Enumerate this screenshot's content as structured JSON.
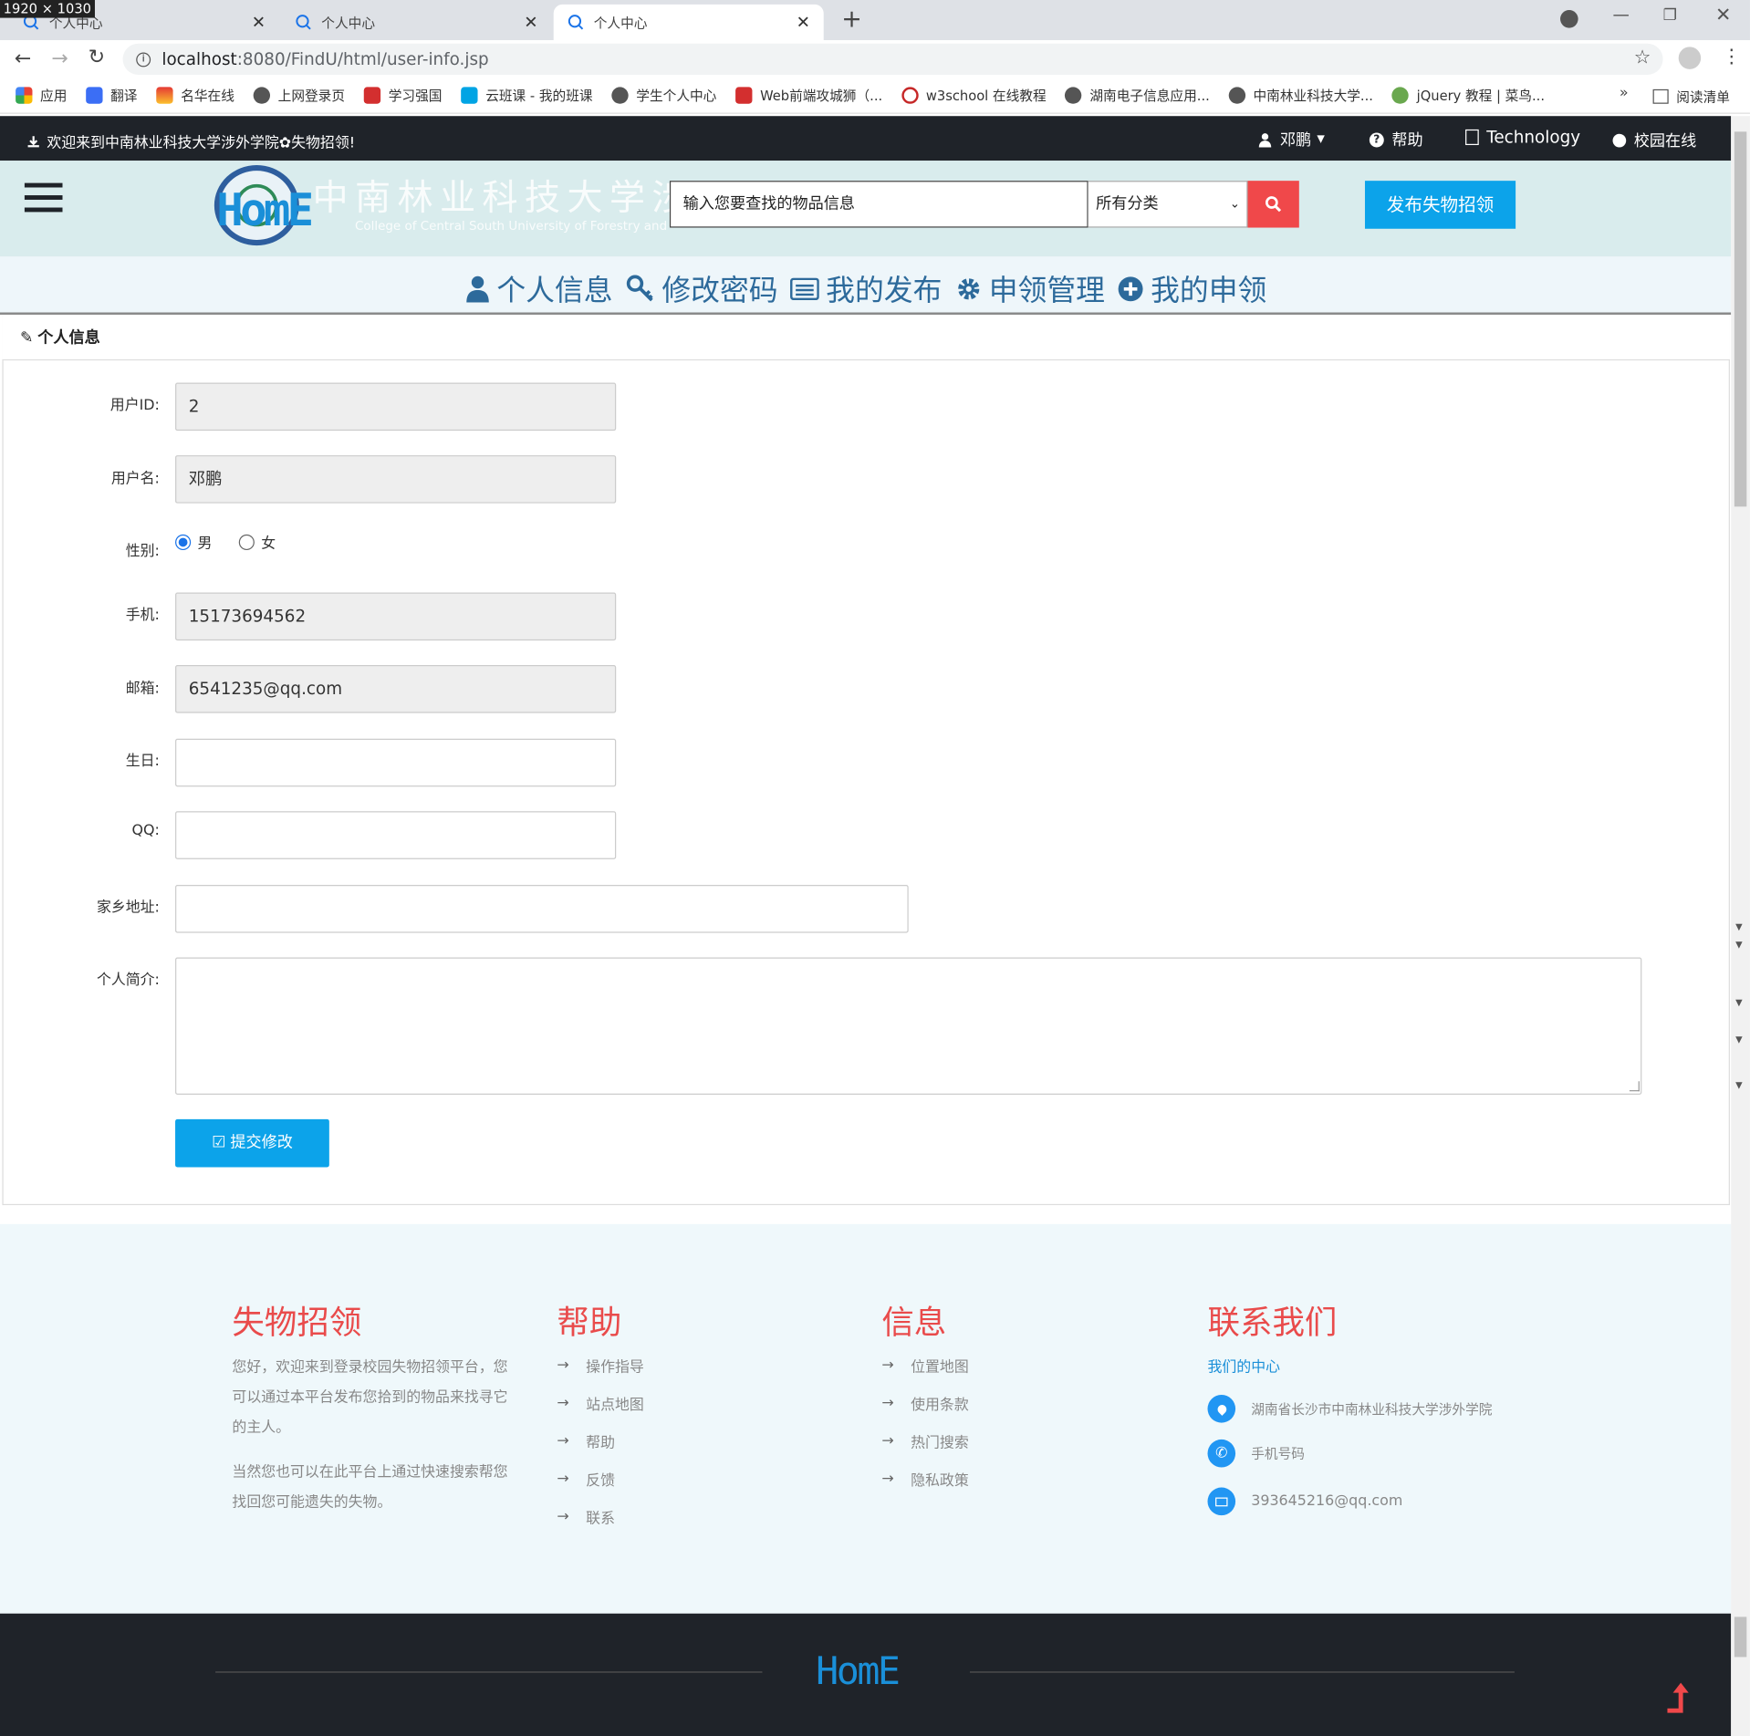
{
  "browser": {
    "size_badge": "1920 × 1030",
    "tabs": [
      {
        "title": "个人中心",
        "active": false
      },
      {
        "title": "个人中心",
        "active": false
      },
      {
        "title": "个人中心",
        "active": true
      }
    ],
    "url_host": "localhost",
    "url_rest": ":8080/FindU/html/user-info.jsp",
    "bookmarks": [
      {
        "label": "应用",
        "color": "#4285f4"
      },
      {
        "label": "翻译",
        "color": "#3b6ef5"
      },
      {
        "label": "名华在线",
        "color": "#e53935"
      },
      {
        "label": "上网登录页",
        "color": "#555555"
      },
      {
        "label": "学习强国",
        "color": "#d32f2f"
      },
      {
        "label": "云班课 - 我的班课",
        "color": "#00a4e4"
      },
      {
        "label": "学生个人中心",
        "color": "#555555"
      },
      {
        "label": "Web前端攻城狮（...",
        "color": "#d32f2f"
      },
      {
        "label": "w3school 在线教程",
        "color": "#c62828"
      },
      {
        "label": "湖南电子信息应用...",
        "color": "#555555"
      },
      {
        "label": "中南林业科技大学...",
        "color": "#555555"
      },
      {
        "label": "jQuery 教程 | 菜鸟...",
        "color": "#6aa84f"
      }
    ],
    "more": "»",
    "reading_list": "阅读清单"
  },
  "topbar": {
    "welcome": "欢迎来到中南林业科技大学涉外学院✿失物招领!",
    "user": "邓鹏",
    "help": "帮助",
    "technology": "Technology",
    "campus": "校园在线"
  },
  "header": {
    "logo_text": "HomE",
    "logo_cn": "中南林业科技大学涉外学院",
    "logo_en": "College of Central South University of Forestry and Technology",
    "search_placeholder": "输入您要查找的物品信息",
    "category": "所有分类",
    "publish_label": "发布失物招领"
  },
  "subnav": [
    "个人信息",
    "修改密码",
    "我的发布",
    "申领管理",
    "我的申领"
  ],
  "panel": {
    "title": "个人信息",
    "fields": {
      "user_id": {
        "label": "用户ID:",
        "value": "2"
      },
      "username": {
        "label": "用户名:",
        "value": "邓鹏"
      },
      "gender": {
        "label": "性别:",
        "options": [
          "男",
          "女"
        ],
        "selected": "男"
      },
      "phone": {
        "label": "手机:",
        "value": "15173694562"
      },
      "email": {
        "label": "邮箱:",
        "value": "6541235@qq.com"
      },
      "birthday": {
        "label": "生日:",
        "value": ""
      },
      "qq": {
        "label": "QQ:",
        "value": ""
      },
      "hometown": {
        "label": "家乡地址:",
        "value": ""
      },
      "bio": {
        "label": "个人简介:",
        "value": ""
      }
    },
    "submit_label": "提交修改"
  },
  "footer": {
    "col1": {
      "heading": "失物招领",
      "p1": "您好，欢迎来到登录校园失物招领平台，您可以通过本平台发布您拾到的物品来找寻它的主人。",
      "p2": "当然您也可以在此平台上通过快速搜索帮您找回您可能遗失的失物。"
    },
    "col2": {
      "heading": "帮助",
      "links": [
        "操作指导",
        "站点地图",
        "帮助",
        "反馈",
        "联系"
      ]
    },
    "col3": {
      "heading": "信息",
      "links": [
        "位置地图",
        "使用条款",
        "热门搜索",
        "隐私政策"
      ]
    },
    "col4": {
      "heading": "联系我们",
      "sub": "我们的中心",
      "address": "湖南省长沙市中南林业科技大学涉外学院",
      "phone": "手机号码",
      "email": "393645216@qq.com"
    },
    "brand": "HomE"
  },
  "colors": {
    "accent": "#0ca3ea",
    "danger": "#f0484a",
    "dark": "#1f2329",
    "nav": "#2d6a9b"
  }
}
